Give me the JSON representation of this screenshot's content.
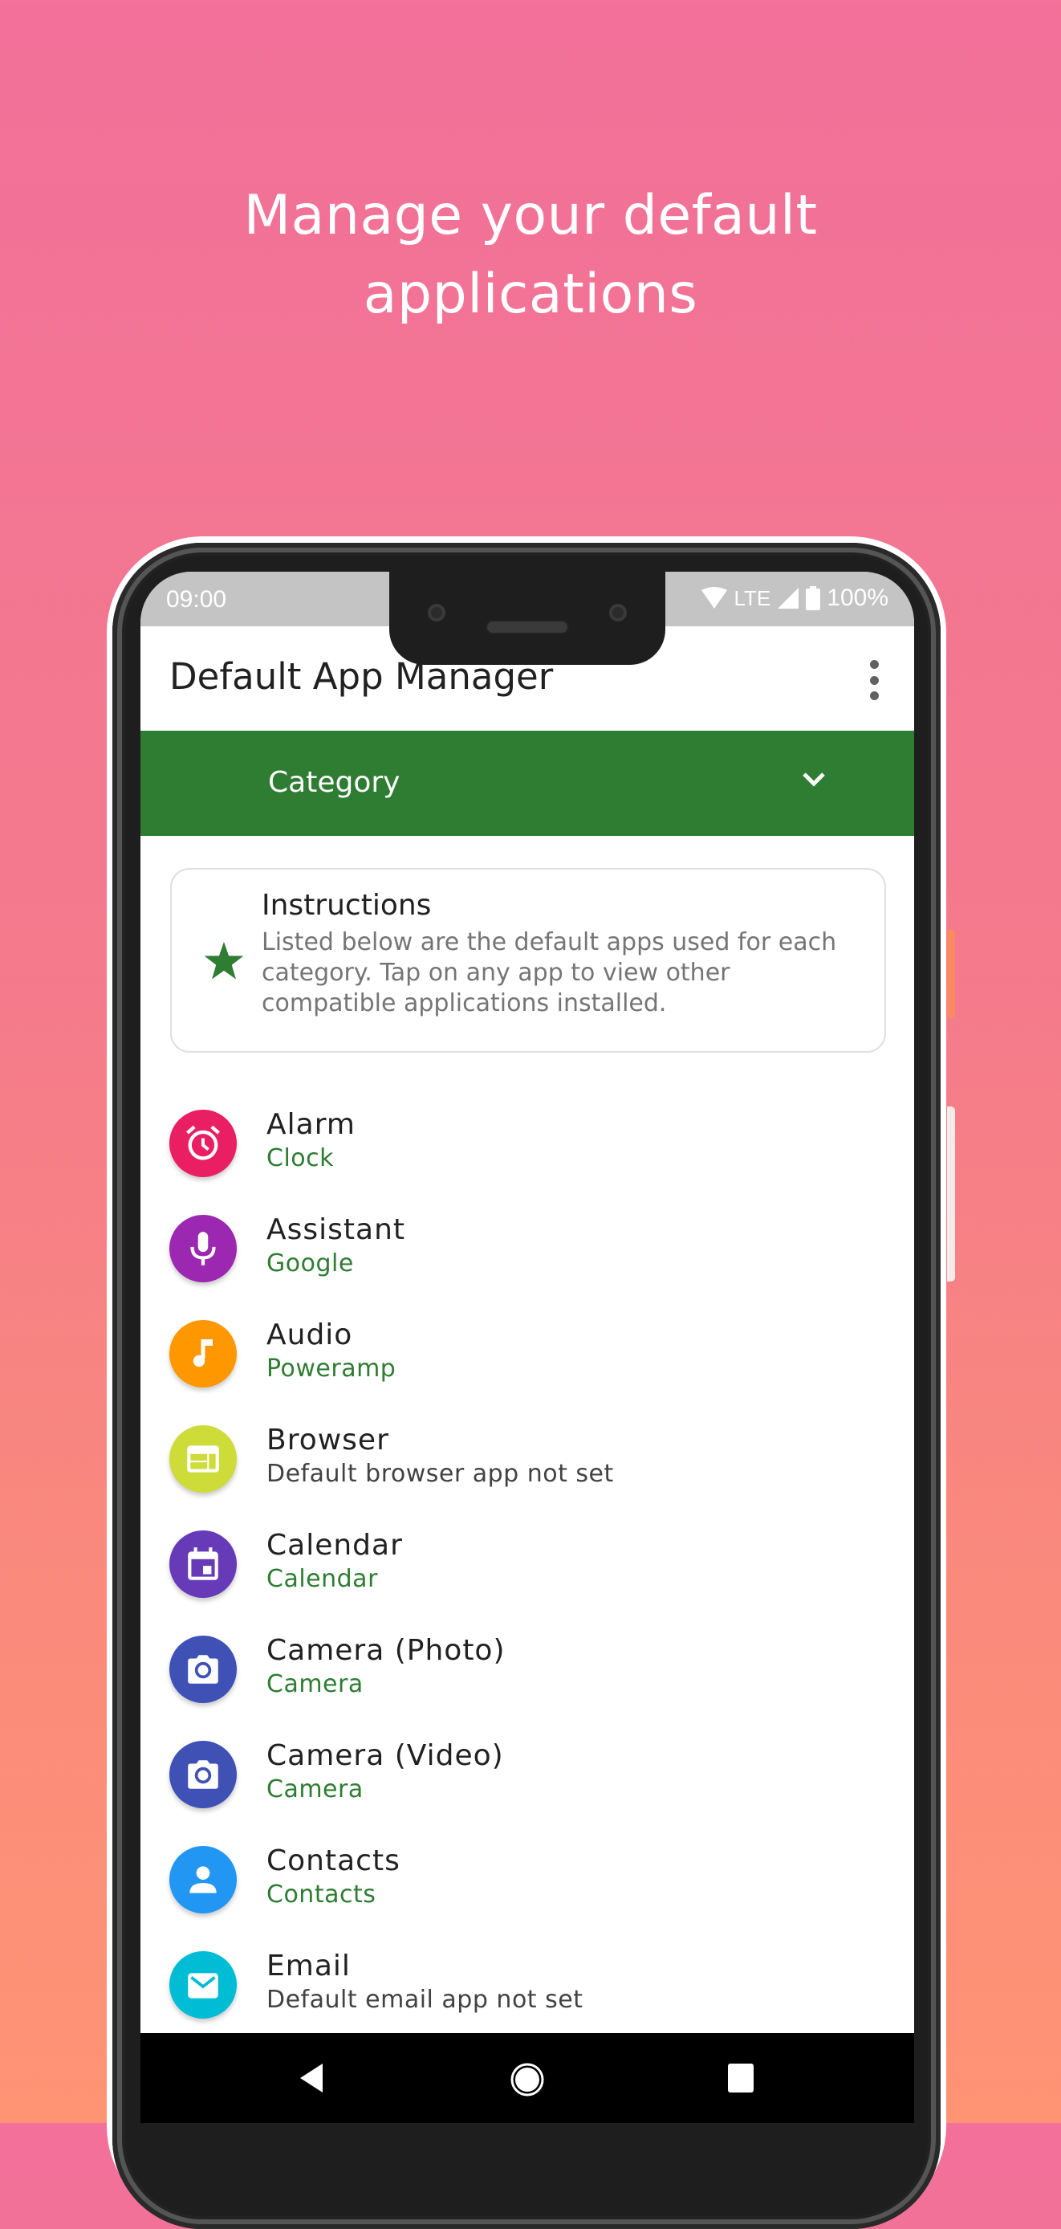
{
  "headline": {
    "line1": "Manage your default",
    "line2": "applications"
  },
  "status_bar": {
    "time": "09:00",
    "network": "LTE",
    "battery": "100%",
    "icons": [
      "wifi-icon",
      "signal-icon",
      "battery-icon"
    ]
  },
  "app_bar": {
    "title": "Default App Manager",
    "overflow_icon": "more-vert-icon"
  },
  "category_dropdown": {
    "label": "Category",
    "icon": "chevron-down-icon",
    "color": "#2e7d32"
  },
  "instructions_card": {
    "title": "Instructions",
    "body": "Listed below are the default apps used for each category. Tap on any app to view other compatible applications installed.",
    "icon": "star-icon"
  },
  "accent_color": "#2e7d32",
  "list": [
    {
      "title": "Alarm",
      "subtitle": "Clock",
      "is_set": true,
      "icon": "alarm-icon",
      "color": "#e91e63"
    },
    {
      "title": "Assistant",
      "subtitle": "Google",
      "is_set": true,
      "icon": "mic-icon",
      "color": "#9c27b0"
    },
    {
      "title": "Audio",
      "subtitle": "Poweramp",
      "is_set": true,
      "icon": "music-note-icon",
      "color": "#ff9800"
    },
    {
      "title": "Browser",
      "subtitle": "Default browser app not set",
      "is_set": false,
      "icon": "web-icon",
      "color": "#cddc39"
    },
    {
      "title": "Calendar",
      "subtitle": "Calendar",
      "is_set": true,
      "icon": "calendar-icon",
      "color": "#673ab7"
    },
    {
      "title": "Camera (Photo)",
      "subtitle": "Camera",
      "is_set": true,
      "icon": "camera-icon",
      "color": "#3f51b5"
    },
    {
      "title": "Camera (Video)",
      "subtitle": "Camera",
      "is_set": true,
      "icon": "camera-icon",
      "color": "#3f51b5"
    },
    {
      "title": "Contacts",
      "subtitle": "Contacts",
      "is_set": true,
      "icon": "person-icon",
      "color": "#2196f3"
    },
    {
      "title": "Email",
      "subtitle": "Default email app not set",
      "is_set": false,
      "icon": "email-icon",
      "color": "#00bcd4"
    }
  ],
  "nav_bar": {
    "buttons": [
      "back-icon",
      "home-icon",
      "recents-icon"
    ]
  }
}
